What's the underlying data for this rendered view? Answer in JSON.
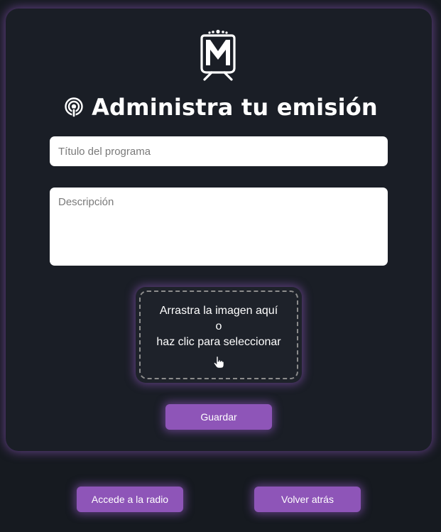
{
  "header": {
    "logo_icon": "radio-mic-logo-icon",
    "title_icon": "podcast-icon",
    "title": "Administra tu emisión"
  },
  "form": {
    "title_placeholder": "Título del programa",
    "title_value": "",
    "description_placeholder": "Descripción",
    "description_value": "",
    "dropzone": {
      "line1": "Arrastra la imagen aquí",
      "line2": "o",
      "line3": "haz clic para seleccionar",
      "icon": "pointer-hand-icon"
    },
    "save_label": "Guardar"
  },
  "footer": {
    "radio_label": "Accede a la radio",
    "back_label": "Volver atrás"
  },
  "colors": {
    "background": "#161a20",
    "card": "#1a1e26",
    "accent": "#8e55b8",
    "glow": "#9a5ac8"
  }
}
